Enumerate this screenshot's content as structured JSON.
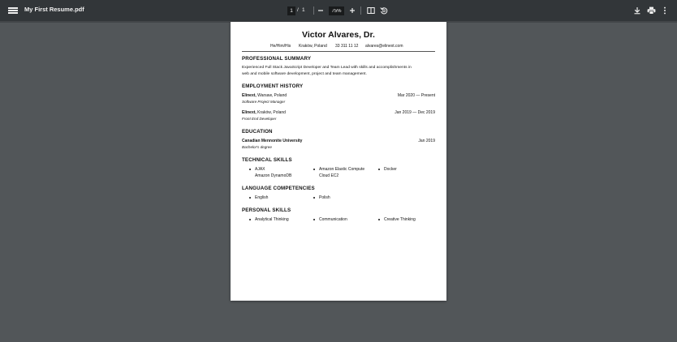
{
  "toolbar": {
    "title": "My First Resume.pdf",
    "page_current": "1",
    "page_separator": "/",
    "page_total": "1",
    "zoom": "75%"
  },
  "resume": {
    "name": "Victor Alvares, Dr.",
    "contact": [
      "He/Him/His",
      "Kraków, Poland",
      "33 311 11 12",
      "alvares@elinext.com"
    ],
    "summary_heading": "PROFESSIONAL SUMMARY",
    "summary_line1": "Experienced Full Stack JavaScript Developer and Team Lead with skills and accomplishments in",
    "summary_line2": "web and mobile software development, project and team management.",
    "employment_heading": "EMPLOYMENT HISTORY",
    "jobs": [
      {
        "company": "Elinext,",
        "location": " Warsaw, Poland",
        "role": "Software Project Manager",
        "dates": "Mar 2020 — Present"
      },
      {
        "company": "Elinext,",
        "location": " Kraków, Poland",
        "role": "Front End Developer",
        "dates": "Jan 2019 — Dec 2019"
      }
    ],
    "education_heading": "EDUCATION",
    "school": "Canadian Mennonite University",
    "degree": "Bachelor's degree",
    "edu_date": "Jan 2019",
    "tech_heading": "TECHNICAL SKILLS",
    "tech_skills": [
      "AJAX",
      "Amazon DynamoDB",
      "Amazon Elastic Compute",
      "Cloud EC2",
      "Docker"
    ],
    "lang_heading": "LANGUAGE COMPETENCIES",
    "languages": [
      "English",
      "Polish"
    ],
    "personal_heading": "PERSONAL SKILLS",
    "personal_skills": [
      "Analytical Thinking",
      "Communication",
      "Creative Thinking"
    ]
  },
  "icons": {
    "menu": "menu-icon",
    "zoom_out": "minus-icon",
    "zoom_in": "plus-icon",
    "fit": "fit-to-page-icon",
    "rotate": "rotate-icon",
    "download": "download-icon",
    "print": "print-icon",
    "more": "more-vert-icon"
  },
  "colors": {
    "toolbar": "#323639",
    "background": "#525659",
    "page": "#ffffff"
  }
}
